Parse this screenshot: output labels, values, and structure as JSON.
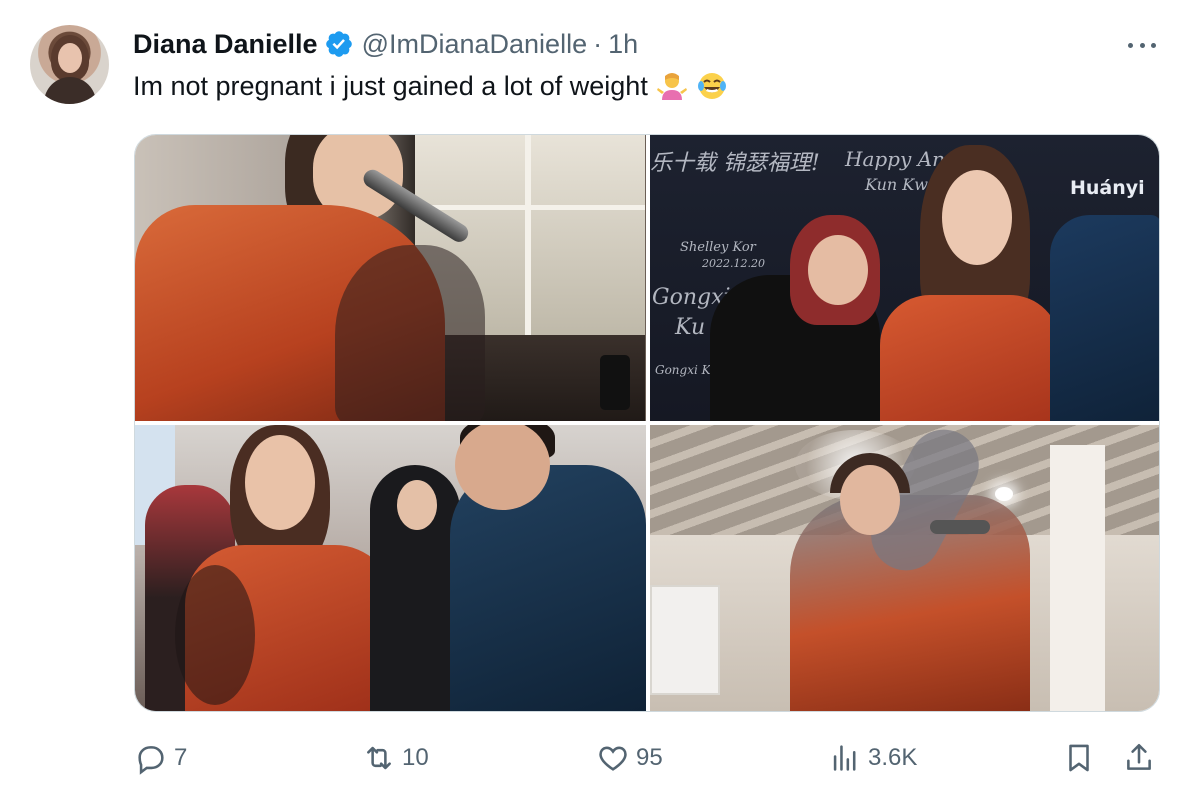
{
  "tweet": {
    "author_name": "Diana Danielle",
    "handle": "@ImDianaDanielle",
    "separator": "·",
    "time": "1h",
    "text": "Im not pregnant i just gained a lot of weight",
    "emojis": [
      "person-shrugging-emoji",
      "face-with-tears-of-joy-emoji"
    ]
  },
  "photo_wall_text": {
    "brand": "Huányi",
    "happy": "Happy Anniv",
    "kun": "Kun Kw",
    "gongxi": "Gongxi",
    "ku": "Ku",
    "chinese": "乐十载 锦瑟福理!",
    "shelly": "Shelley Kor",
    "date": "2022.12.20",
    "gongxi_small": "Gongxi Kuan"
  },
  "actions": {
    "reply_count": "7",
    "retweet_count": "10",
    "like_count": "95",
    "views_count": "3.6K"
  },
  "colors": {
    "verified": "#1d9bf0",
    "text_primary": "#0f1419",
    "text_secondary": "#536471",
    "border": "#cfd9de"
  }
}
